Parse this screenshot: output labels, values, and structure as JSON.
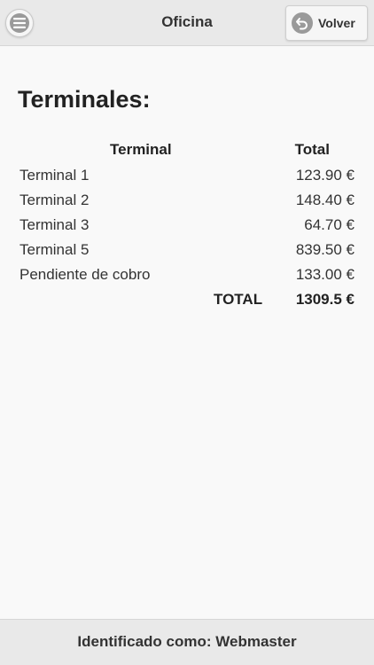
{
  "header": {
    "title": "Oficina",
    "menu_icon": "hamburger-menu-icon",
    "back_label": "Volver",
    "back_icon": "back-arrow-icon"
  },
  "main": {
    "heading": "Terminales:",
    "table": {
      "columns": [
        "Terminal",
        "Total"
      ],
      "rows": [
        {
          "name": "Terminal 1",
          "total": "123.90 €"
        },
        {
          "name": "Terminal 2",
          "total": "148.40 €"
        },
        {
          "name": "Terminal 3",
          "total": "64.70 €"
        },
        {
          "name": "Terminal 5",
          "total": "839.50 €"
        },
        {
          "name": "Pendiente de cobro",
          "total": "133.00 €"
        }
      ],
      "total_label": "TOTAL",
      "total_value": "1309.5 €"
    }
  },
  "footer": {
    "text": "Identificado como: Webmaster"
  },
  "colors": {
    "bar_background": "#e9e9e9",
    "page_background": "#f9f9f9",
    "icon_disc": "#9a9a9a"
  }
}
